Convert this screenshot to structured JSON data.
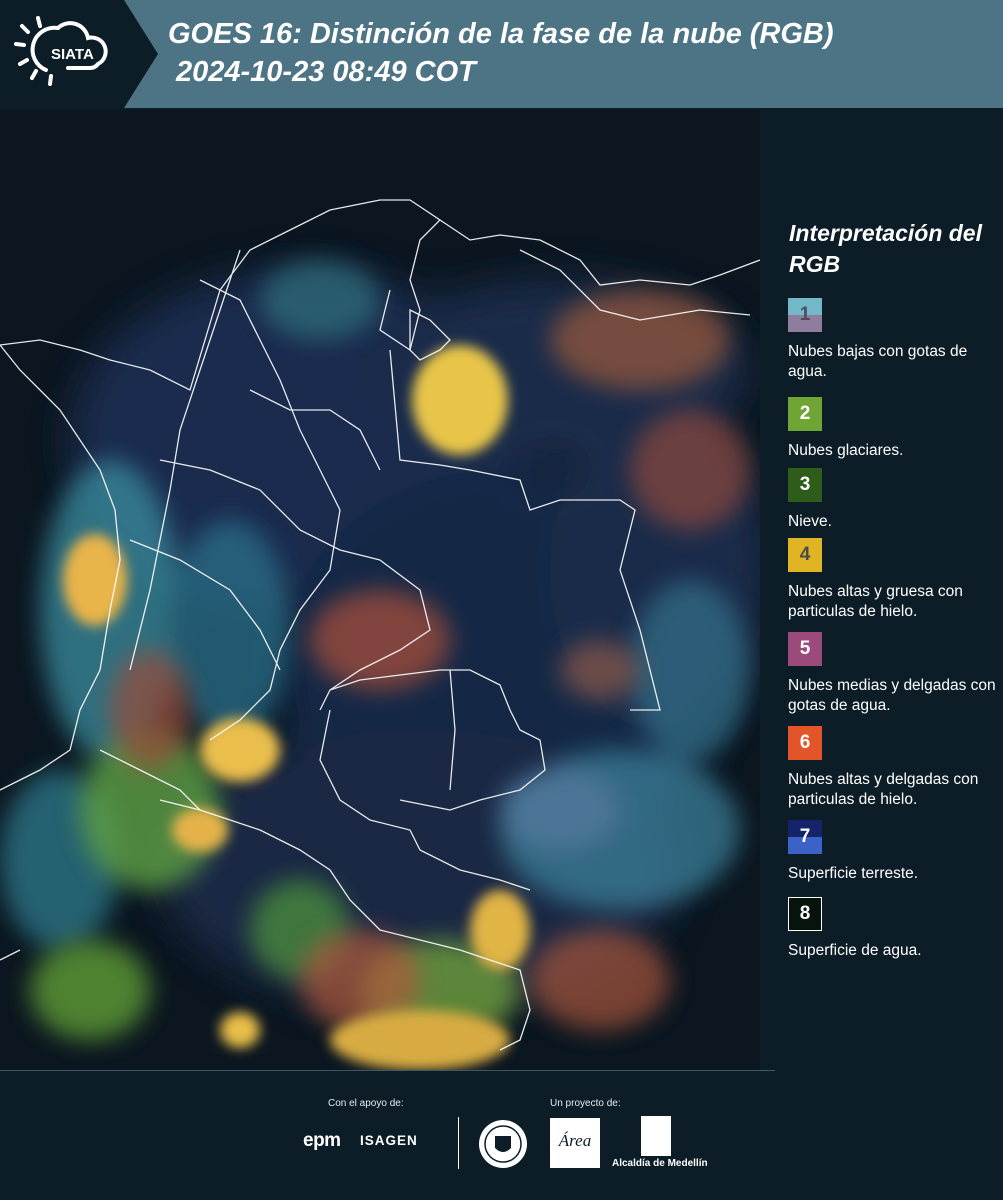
{
  "header": {
    "logo_text": "SIATA",
    "title": "GOES 16: Distinción de la fase de la nube (RGB)",
    "subtitle": "2024-10-23 08:49 COT"
  },
  "legend": {
    "title": "Interpretación del RGB",
    "items": [
      {
        "number": "1",
        "description": "Nubes bajas con gotas de agua.",
        "color_top": "#72b8c8",
        "color_bottom": "#8f7d9e",
        "text_color": "#4b4b5e"
      },
      {
        "number": "2",
        "description": "Nubes glaciares.",
        "color": "#6ea534",
        "text_color": "#ffffff"
      },
      {
        "number": "3",
        "description": "Nieve.",
        "color": "#2e5c1a",
        "text_color": "#ffffff"
      },
      {
        "number": "4",
        "description": "Nubes altas y gruesa con particulas de hielo.",
        "color": "#e0b424",
        "text_color": "#4b4b4b"
      },
      {
        "number": "5",
        "description": "Nubes medias y delgadas con gotas de agua.",
        "color": "#9b4a7c",
        "text_color": "#ffffff"
      },
      {
        "number": "6",
        "description": "Nubes altas y delgadas con particulas de hielo.",
        "color": "#e35529",
        "text_color": "#ffffff"
      },
      {
        "number": "7",
        "description": "Superficie terreste.",
        "color_top": "#14246a",
        "color_bottom": "#3b62c7",
        "text_color": "#ffffff"
      },
      {
        "number": "8",
        "description": "Superficie de agua.",
        "color": "#07140c",
        "text_color": "#ffffff",
        "border": "#ffffff"
      }
    ]
  },
  "footer": {
    "support_label": "Con el apoyo de:",
    "project_label": "Un proyecto de:",
    "epm": "epm",
    "isagen": "ISAGEN",
    "amva_text": "Área",
    "alcaldia": "Alcaldía de Medellín"
  }
}
